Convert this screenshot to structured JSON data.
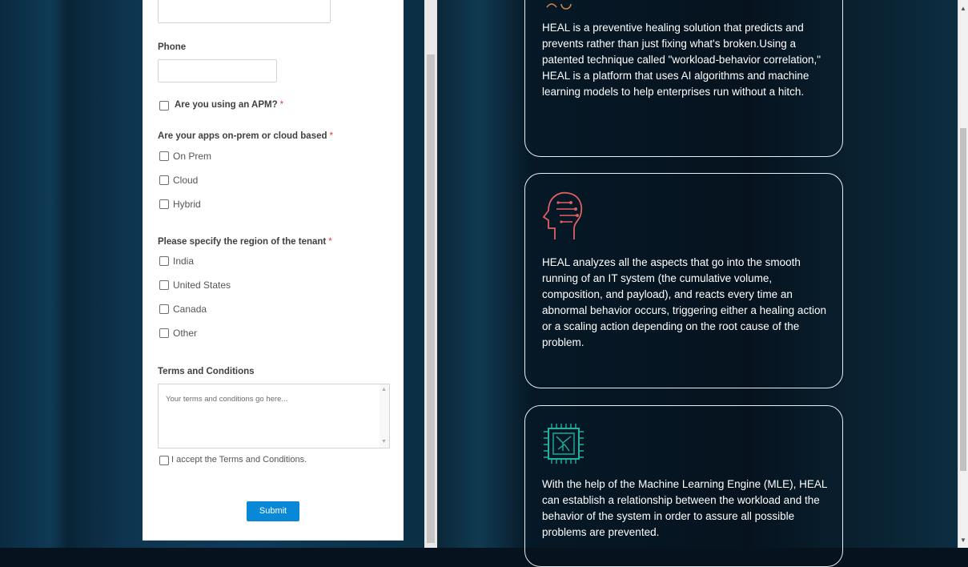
{
  "form": {
    "phone_label": "Phone",
    "phone_value": "",
    "apm_label": "Are you using an APM?",
    "required_mark": "*",
    "apps_label": "Are your apps on-prem or cloud based",
    "apps_options": [
      "On Prem",
      "Cloud",
      "Hybrid"
    ],
    "region_label": "Please specify the region of the tenant",
    "region_options": [
      "India",
      "United States",
      "Canada",
      "Other"
    ],
    "terms_label": "Terms and Conditions",
    "terms_placeholder": "Your terms and conditions go here...",
    "accept_label": "I accept the Terms and Conditions.",
    "submit_label": "Submit"
  },
  "cards": [
    {
      "text": "HEAL is a preventive healing solution that predicts and prevents rather than just fixing what's broken.Using a patented technique called \"workload-behavior correlation,\" HEAL is a platform that uses AI algorithms and machine learning models to help enterprises run without a hitch."
    },
    {
      "icon": "brain-head-icon",
      "text": "HEAL analyzes all the aspects that go into the smooth running of an IT system (the cumulative volume, composition, and payload), and reacts every time an abnormal behavior occurs, triggering either a healing action or a scaling action depending on the root cause of the problem."
    },
    {
      "icon": "chip-icon",
      "text": "With the help of the Machine Learning Engine (MLE), HEAL can establish a relationship between the workload and the behavior of the system in order to assure all possible problems are prevented."
    }
  ],
  "colors": {
    "accent_button": "#0a88d8",
    "required": "#e03a3a",
    "brain_icon": "#e06060",
    "chip_icon": "#1fb0a0"
  }
}
